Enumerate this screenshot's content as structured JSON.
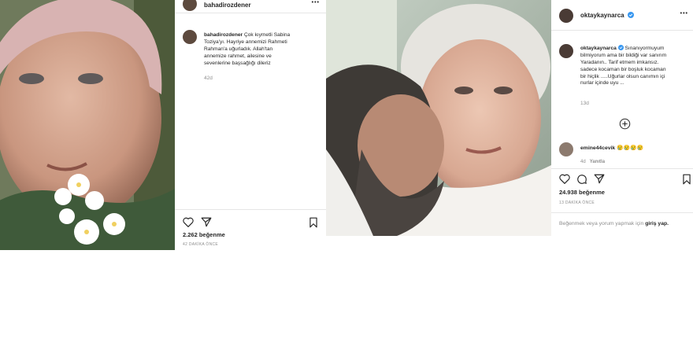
{
  "post1": {
    "username": "bahadirozdener",
    "more_label": "•••",
    "caption_user": "bahadirozdener",
    "caption_lines": [
      "Çok kıymetli Sabina",
      "Toziya'yı. Hayriye annemizi Rahmeti",
      "Rahman'a uğurladık. Allah'tan",
      "annemize rahmet, ailesine ve",
      "sevenlerine başsağlığı dileriz"
    ],
    "caption_time": "42d",
    "likes": "2.262 beğenme",
    "timestamp": "42 DAKİKA ÖNCE",
    "icons": [
      "heart-icon",
      "share-icon",
      "bookmark-icon"
    ]
  },
  "post2": {
    "username": "oktaykaynarca",
    "more_label": "•••",
    "caption_user": "oktaykaynarca",
    "caption_lines": [
      "Sınanıyormuyum",
      "bilmiyorum ama bir bildiği var sanırım",
      "Yaradanın.. Tarif etmem imkansız.",
      "sadece kocaman bir boşluk kocaman",
      "bir hiçlik .....Uğurlar olsun canımın içi",
      "nurlar içinde uyu ..."
    ],
    "caption_time": "13d",
    "comment_user": "emine44cevik",
    "comment_text": "😢😢😢😢",
    "comment_time": "4d",
    "comment_reply": "Yanıtla",
    "likes": "24.938 beğenme",
    "timestamp": "13 DAKİKA ÖNCE",
    "login_prefix": "Beğenmek veya yorum yapmak için",
    "login_link": "giriş yap.",
    "icons": [
      "heart-icon",
      "comment-icon",
      "share-icon",
      "bookmark-icon",
      "add-circle-icon",
      "verified-icon"
    ]
  },
  "colors": {
    "text": "#262626",
    "muted": "#8e8e8e",
    "link": "#0095f6",
    "verified": "#3897f0",
    "border": "#e6e6e6"
  }
}
